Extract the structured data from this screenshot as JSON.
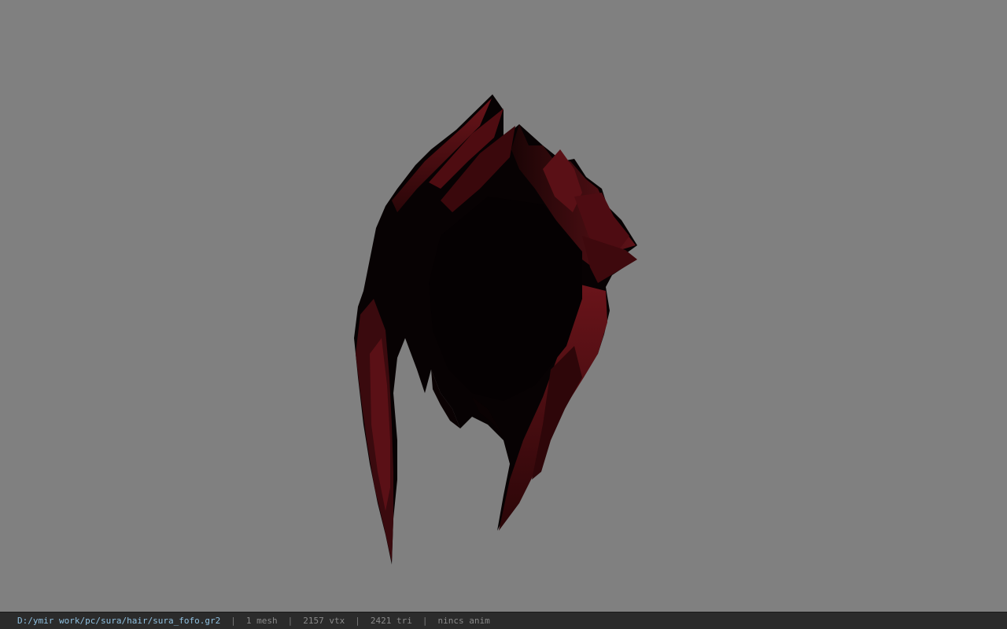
{
  "viewport": {
    "background": "#808080",
    "model_icon": "hair-mesh-render",
    "hair_color_dark": "#0a0304",
    "hair_color_red": "#5a0f14"
  },
  "status_bar": {
    "file_path": "D:/ymir work/pc/sura/hair/sura_fofo.gr2",
    "separator": "|",
    "mesh_count": "1 mesh",
    "vertex_count": "2157 vtx",
    "triangle_count": "2421 tri",
    "anim_status": "nincs anim"
  }
}
